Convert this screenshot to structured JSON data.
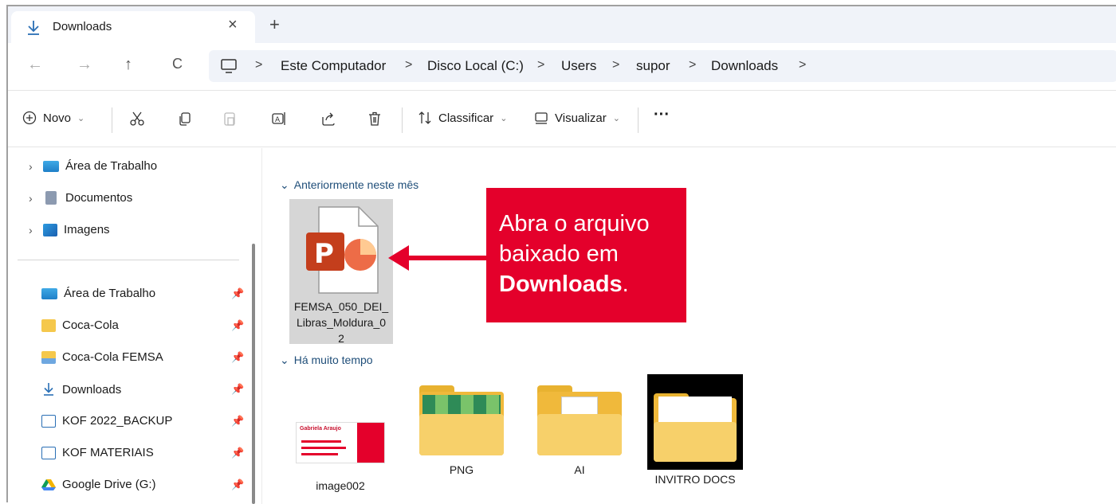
{
  "tab": {
    "title": "Downloads",
    "close": "×",
    "new": "+"
  },
  "nav": {
    "back": "←",
    "forward": "→",
    "up": "↑",
    "refresh": "C"
  },
  "breadcrumb": [
    "Este Computador",
    "Disco Local (C:)",
    "Users",
    "supor",
    "Downloads"
  ],
  "breadcrumb_sep": ">",
  "toolbar": {
    "new_label": "Novo",
    "sort_label": "Classificar",
    "view_label": "Visualizar",
    "more": "···"
  },
  "sidebar": {
    "top_items": [
      {
        "label": "Área de Trabalho",
        "icon": "desktop-icon"
      },
      {
        "label": "Documentos",
        "icon": "documents-icon"
      },
      {
        "label": "Imagens",
        "icon": "pictures-icon"
      }
    ],
    "pinned_items": [
      {
        "label": "Área de Trabalho",
        "icon": "desktop-icon"
      },
      {
        "label": "Coca-Cola",
        "icon": "onedrive-folder-icon"
      },
      {
        "label": "Coca-Cola FEMSA",
        "icon": "people-folder-icon"
      },
      {
        "label": "Downloads",
        "icon": "download-icon"
      },
      {
        "label": "KOF 2022_BACKUP",
        "icon": "image-folder-icon"
      },
      {
        "label": "KOF MATERIAIS",
        "icon": "image-folder-icon"
      },
      {
        "label": "Google Drive (G:)",
        "icon": "google-drive-icon"
      }
    ]
  },
  "groups": {
    "recent": "Anteriormente neste mês",
    "old": "Há muito tempo"
  },
  "files": {
    "recent": {
      "name_line1": "FEMSA_050_DEI_",
      "name_line2": "Libras_Moldura_0",
      "name_line3": "2"
    },
    "old": [
      {
        "name": "image002"
      },
      {
        "name": "PNG"
      },
      {
        "name": "AI"
      },
      {
        "name": "INVITRO DOCS"
      }
    ]
  },
  "card_preview": {
    "name": "Gabriela Araujo"
  },
  "callout": {
    "line1": "Abra o arquivo",
    "line2": "baixado em",
    "bold": "Downloads",
    "tail": "."
  },
  "colors": {
    "callout": "#e4002b",
    "folder": "#f5c84c",
    "ppt": "#c43e1c"
  }
}
